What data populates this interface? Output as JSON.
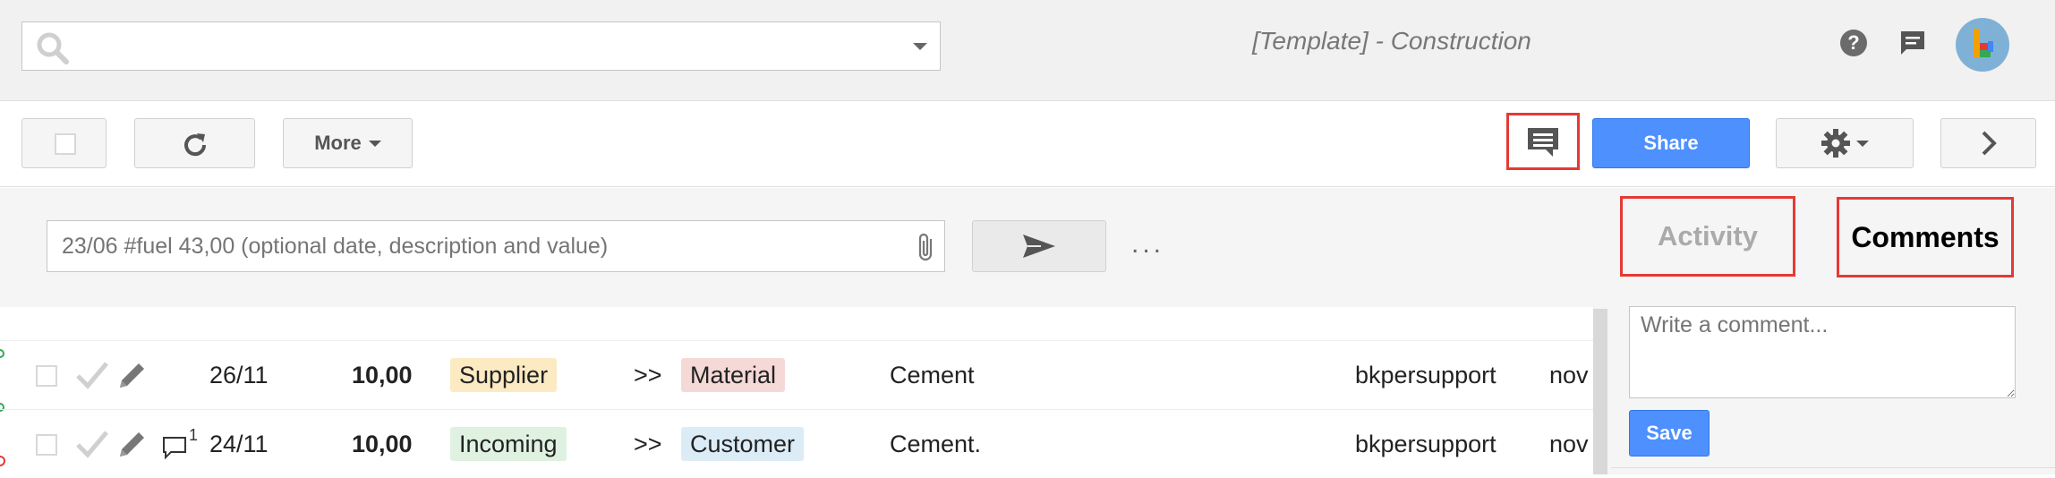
{
  "header": {
    "search_placeholder": "",
    "title": "[Template] - Construction"
  },
  "icons": {
    "search": "search-icon",
    "dropdown": "chevron-down-icon",
    "help": "help-icon",
    "feedback": "feedback-icon",
    "avatar": "avatar",
    "refresh": "refresh-icon",
    "comments": "comments-icon",
    "settings": "gear-icon",
    "next": "chevron-right-icon",
    "attach": "paperclip-icon",
    "send": "send-icon"
  },
  "toolbar": {
    "more_label": "More",
    "share_label": "Share"
  },
  "entry": {
    "placeholder": "23/06 #fuel 43,00 (optional date, description and value)",
    "more_dots": "..."
  },
  "panel": {
    "tab_activity": "Activity",
    "tab_comments": "Comments",
    "comment_placeholder": "Write a comment...",
    "save_label": "Save"
  },
  "rows": [
    {
      "date": "26/11",
      "amount": "10,00",
      "from": "Supplier",
      "arrow": ">>",
      "to": "Material",
      "description": "Cement",
      "user": "bkpersupport",
      "extra": "nov",
      "comment_count": ""
    },
    {
      "date": "24/11",
      "amount": "10,00",
      "from": "Incoming",
      "arrow": ">>",
      "to": "Customer",
      "description": "Cement.",
      "user": "bkpersupport",
      "extra": "nov",
      "comment_count": "1"
    }
  ],
  "colors": {
    "accent": "#4d90fe",
    "highlight": "#e53935",
    "tag_supplier": "#fbeac2",
    "tag_material": "#f5d9d7",
    "tag_incoming": "#dff1e1",
    "tag_customer": "#dcecf7"
  }
}
